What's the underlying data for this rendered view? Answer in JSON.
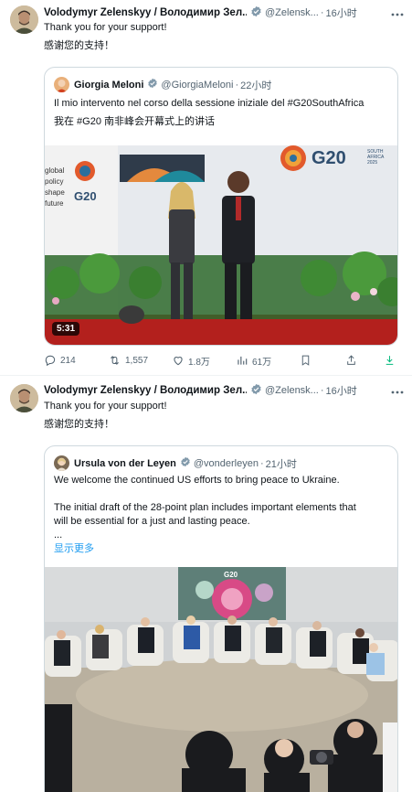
{
  "tweets": [
    {
      "author": {
        "name": "Volodymyr Zelenskyy / Володимир Зел...",
        "handle": "@Zelensk...",
        "time": "16小时"
      },
      "text_en": "Thank you for your support!",
      "text_zh": "感谢您的支持！",
      "quote": {
        "name": "Giorgia Meloni",
        "handle": "@GiorgiaMeloni",
        "time": "22小时",
        "line1": "Il mio intervento nel corso della sessione iniziale del #G20SouthAfrica",
        "line2": "我在 #G20 南非峰会开幕式上的讲话",
        "video_duration": "5:31",
        "banner_left": [
          "global",
          "policy",
          "shape",
          "future"
        ],
        "banner_g20": "G20",
        "banner_south": [
          "SOUTH",
          "AFRICA",
          "2025"
        ]
      },
      "actions": {
        "replies": "214",
        "retweets": "1,557",
        "likes": "1.8万",
        "views": "61万"
      }
    },
    {
      "author": {
        "name": "Volodymyr Zelenskyy / Володимир Зел...",
        "handle": "@Zelensk...",
        "time": "16小时"
      },
      "text_en": "Thank you for your support!",
      "text_zh": "感谢您的支持！",
      "quote": {
        "name": "Ursula von der Leyen",
        "handle": "@vonderleyen",
        "time": "21小时",
        "line1": "We welcome the continued US efforts to bring peace to Ukraine.",
        "line2": "The initial draft of the 28-point plan includes important elements that",
        "line3": "will be essential for a just and lasting peace.",
        "line4": "...",
        "show_more": "显示更多",
        "banner_g20": "G20"
      }
    }
  ],
  "colors": {
    "accent": "#1d9bf0",
    "verified": "#829aab",
    "muted": "#536471",
    "border": "#cfd9de",
    "divider": "#eff3f4"
  },
  "icons": [
    "avatar",
    "verified-badge-icon",
    "more-icon",
    "reply-icon",
    "retweet-icon",
    "like-icon",
    "views-icon",
    "bookmark-icon",
    "share-icon",
    "download-icon"
  ]
}
